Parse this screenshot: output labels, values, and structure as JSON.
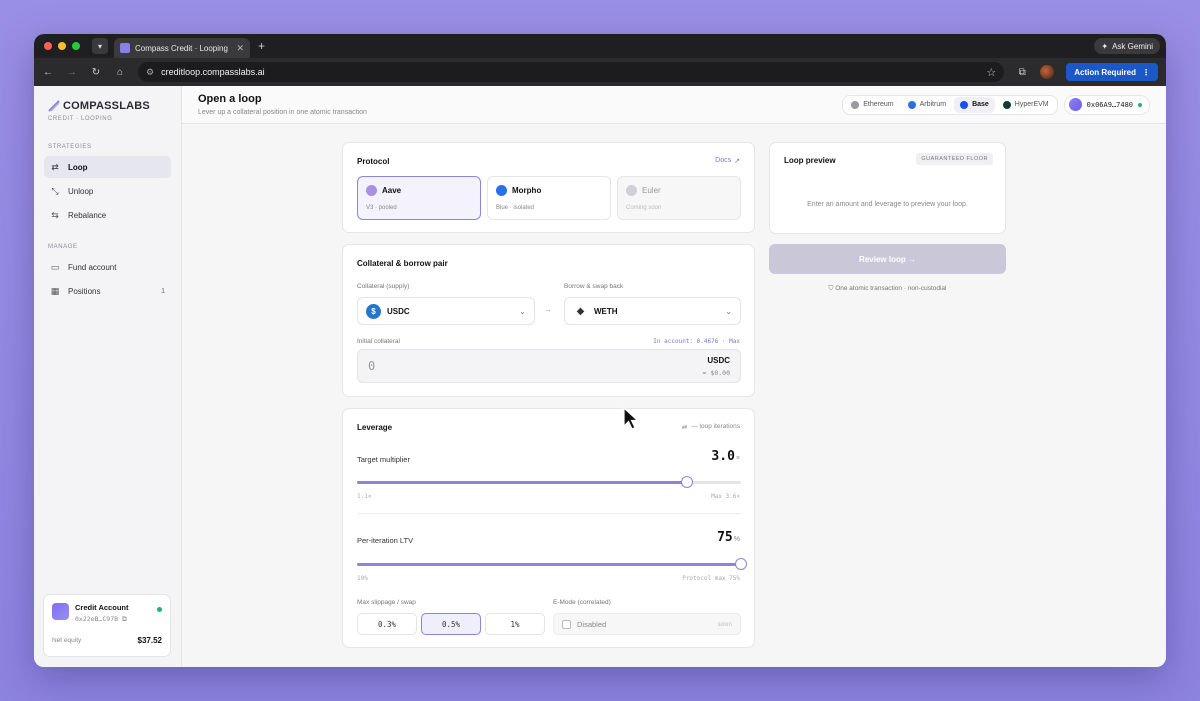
{
  "browser": {
    "tab_title": "Compass Credit · Looping",
    "gemini_label": "Ask Gemini",
    "url": "creditloop.compasslabs.ai",
    "action_label": "Action Required"
  },
  "sidebar": {
    "logo_text": "COMPASSLABS",
    "logo_sub": "CREDIT · LOOPING",
    "strategies_title": "STRATEGIES",
    "strategies": [
      {
        "label": "Loop",
        "icon": "loop-icon"
      },
      {
        "label": "Unloop",
        "icon": "unloop-icon"
      },
      {
        "label": "Rebalance",
        "icon": "rebalance-icon"
      }
    ],
    "manage_title": "MANAGE",
    "manage": [
      {
        "label": "Fund account",
        "icon": "wallet-icon"
      },
      {
        "label": "Positions",
        "icon": "grid-icon",
        "count": "1"
      }
    ],
    "account": {
      "name": "Credit Account",
      "address": "0x22eB…C97B",
      "equity_label": "Net equity",
      "equity_value": "$37.52"
    }
  },
  "header": {
    "title": "Open a loop",
    "subtitle": "Lever up a collateral position in one atomic transaction",
    "chains": [
      "Ethereum",
      "Arbitrum",
      "Base",
      "HyperEVM"
    ],
    "active_chain": "Base",
    "wallet": "0x06A9…7480"
  },
  "protocol": {
    "title": "Protocol",
    "docs_label": "Docs",
    "options": [
      {
        "name": "Aave",
        "sub": "V3 · pooled"
      },
      {
        "name": "Morpho",
        "sub": "Blue · isolated"
      },
      {
        "name": "Euler",
        "sub": "Coming soon"
      }
    ]
  },
  "pair": {
    "title": "Collateral & borrow pair",
    "collateral_label": "Collateral (supply)",
    "collateral_value": "USDC",
    "borrow_label": "Borrow & swap back",
    "borrow_value": "WETH",
    "initial_label": "Initial collateral",
    "in_account": "In account: 0.4676 · Max",
    "amount_placeholder": "0",
    "amount_unit": "USDC",
    "amount_usd": "≈ $0.00"
  },
  "leverage": {
    "title": "Leverage",
    "iterations_label": "— loop iterations",
    "target_label": "Target multiplier",
    "target_value": "3.0",
    "target_unit": "×",
    "target_min": "1.1×",
    "target_max": "Max 3.6×",
    "target_fill": 0.86,
    "ltv_label": "Per-iteration LTV",
    "ltv_value": "75",
    "ltv_unit": "%",
    "ltv_min": "10%",
    "ltv_max": "Protocol max 75%",
    "ltv_fill": 1.0,
    "slippage_label": "Max slippage / swap",
    "slippage_options": [
      "0.3%",
      "0.5%",
      "1%"
    ],
    "slippage_selected": "0.5%",
    "emode_label": "E-Mode (correlated)",
    "emode_value": "Disabled",
    "emode_right": "soon"
  },
  "preview": {
    "title": "Loop preview",
    "badge": "GUARANTEED FLOOR",
    "empty_text": "Enter an amount and leverage to preview your loop.",
    "review_label": "Review loop →",
    "footnote": "One atomic transaction · non-custodial"
  },
  "colors": {
    "accent": "#8b84d8",
    "background": "#9a8fe6",
    "success": "#23b26b"
  }
}
